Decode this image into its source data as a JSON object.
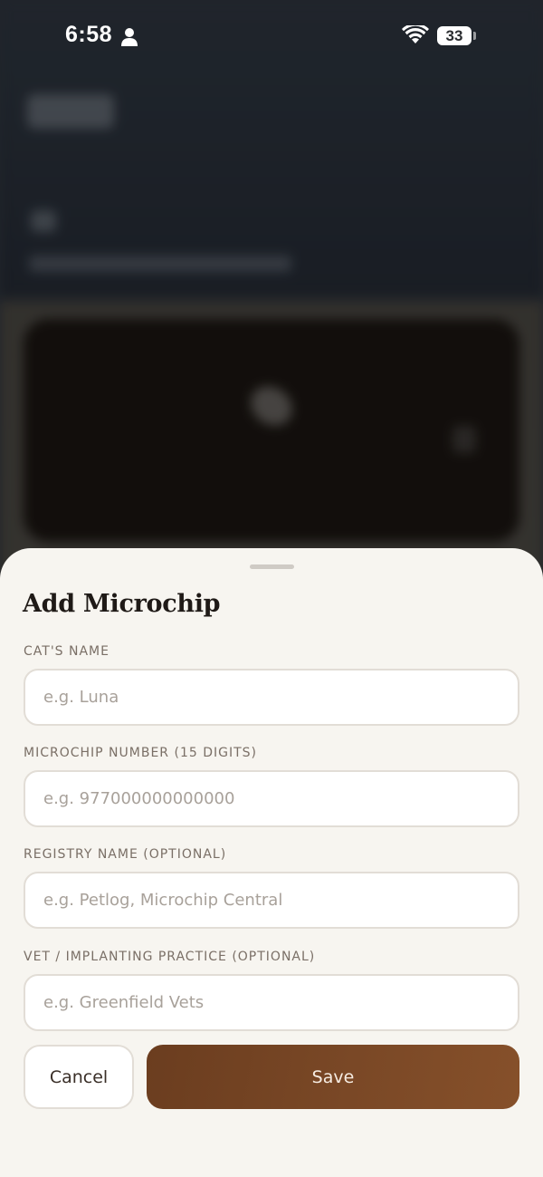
{
  "status_bar": {
    "time": "6:58",
    "battery": "33",
    "icons": [
      "person-icon",
      "wifi-icon",
      "battery-icon"
    ]
  },
  "sheet": {
    "title": "Add Microchip",
    "fields": [
      {
        "label": "CAT'S NAME",
        "placeholder": "e.g. Luna",
        "value": ""
      },
      {
        "label": "MICROCHIP NUMBER (15 DIGITS)",
        "placeholder": "e.g. 977000000000000",
        "value": ""
      },
      {
        "label": "REGISTRY NAME (OPTIONAL)",
        "placeholder": "e.g. Petlog, Microchip Central",
        "value": ""
      },
      {
        "label": "VET / IMPLANTING PRACTICE (OPTIONAL)",
        "placeholder": "e.g. Greenfield Vets",
        "value": ""
      }
    ],
    "cancel_label": "Cancel",
    "save_label": "Save"
  },
  "colors": {
    "sheet_background": "#f7f5f0",
    "save_button": "#7a4826",
    "label_text": "#7a6f66"
  }
}
